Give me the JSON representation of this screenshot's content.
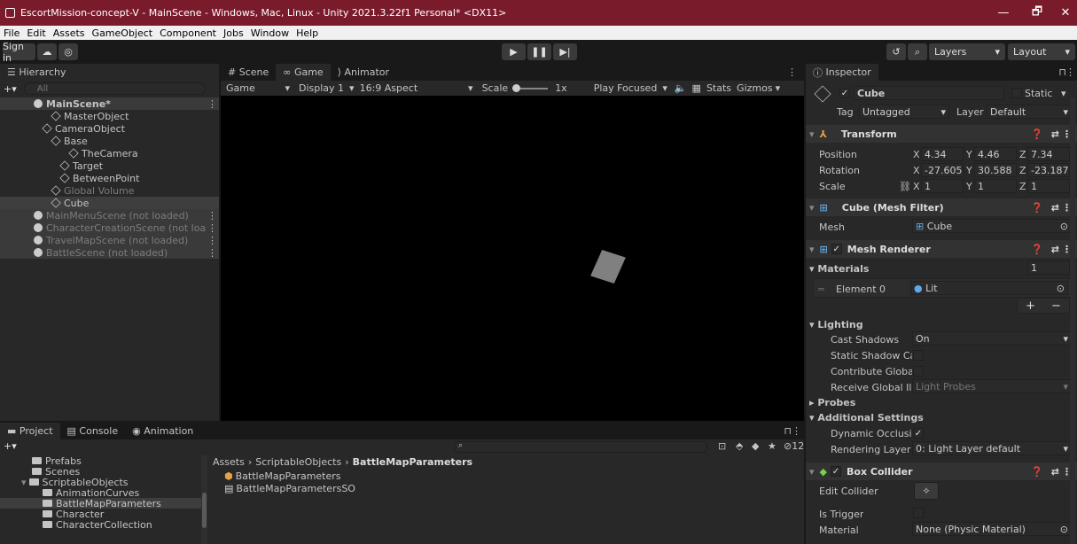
{
  "window": {
    "title": "EscortMission-concept-V - MainScene - Windows, Mac, Linux - Unity 2021.3.22f1 Personal* <DX11>",
    "minimize": "—",
    "maximize": "🗗",
    "close": "✕"
  },
  "menu": [
    "File",
    "Edit",
    "Assets",
    "GameObject",
    "Component",
    "Jobs",
    "Window",
    "Help"
  ],
  "toolbar": {
    "sign_in": "Sign in",
    "layers": "Layers",
    "layout": "Layout"
  },
  "hierarchy": {
    "tab": "Hierarchy",
    "search_placeholder": "All",
    "items": [
      {
        "label": "MainScene*",
        "indent": 0,
        "type": "scene",
        "bold": true
      },
      {
        "label": "MasterObject",
        "indent": 2,
        "type": "obj"
      },
      {
        "label": "CameraObject",
        "indent": 1,
        "type": "obj"
      },
      {
        "label": "Base",
        "indent": 2,
        "type": "obj"
      },
      {
        "label": "TheCamera",
        "indent": 4,
        "type": "obj"
      },
      {
        "label": "Target",
        "indent": 3,
        "type": "obj"
      },
      {
        "label": "BetweenPoint",
        "indent": 3,
        "type": "obj"
      },
      {
        "label": "Global Volume",
        "indent": 2,
        "type": "obj",
        "dim": true
      },
      {
        "label": "Cube",
        "indent": 2,
        "type": "obj",
        "selected": true
      },
      {
        "label": "MainMenuScene (not loaded)",
        "indent": 0,
        "type": "scene",
        "dim": true,
        "unloaded": true
      },
      {
        "label": "CharacterCreationScene (not loa",
        "indent": 0,
        "type": "scene",
        "dim": true,
        "unloaded": true
      },
      {
        "label": "TravelMapScene (not loaded)",
        "indent": 0,
        "type": "scene",
        "dim": true,
        "unloaded": true
      },
      {
        "label": "BattleScene (not loaded)",
        "indent": 0,
        "type": "scene",
        "dim": true,
        "unloaded": true
      }
    ]
  },
  "game": {
    "tabs": [
      "Scene",
      "Game",
      "Animator"
    ],
    "display_mode": "Game",
    "display": "Display 1",
    "aspect": "16:9 Aspect",
    "scale_label": "Scale",
    "scale_value": "1x",
    "play_focused": "Play Focused",
    "stats": "Stats",
    "gizmos": "Gizmos"
  },
  "inspector": {
    "tab": "Inspector",
    "object_name": "Cube",
    "static_label": "Static",
    "tag_label": "Tag",
    "tag_value": "Untagged",
    "layer_label": "Layer",
    "layer_value": "Default",
    "transform": {
      "title": "Transform",
      "position_label": "Position",
      "rotation_label": "Rotation",
      "scale_label": "Scale",
      "position": [
        "4.34",
        "4.46",
        "7.34"
      ],
      "rotation": [
        "-27.605",
        "30.588",
        "-23.187"
      ],
      "scale": [
        "1",
        "1",
        "1"
      ]
    },
    "mesh_filter": {
      "title": "Cube (Mesh Filter)",
      "mesh_label": "Mesh",
      "mesh_value": "Cube"
    },
    "mesh_renderer": {
      "title": "Mesh Renderer",
      "materials_label": "Materials",
      "materials_count": "1",
      "element0_label": "Element 0",
      "element0_value": "Lit",
      "lighting_label": "Lighting",
      "cast_shadows_label": "Cast Shadows",
      "cast_shadows_value": "On",
      "static_shadow_label": "Static Shadow Cas",
      "contribute_gi_label": "Contribute Global I",
      "receive_gi_label": "Receive Global Illu",
      "receive_gi_value": "Light Probes",
      "probes_label": "Probes",
      "additional_label": "Additional Settings",
      "dynamic_occlusion_label": "Dynamic Occlusio",
      "rendering_layer_label": "Rendering Layer M",
      "rendering_layer_value": "0: Light Layer default"
    },
    "box_collider": {
      "title": "Box Collider",
      "edit_label": "Edit Collider",
      "trigger_label": "Is Trigger",
      "material_label": "Material",
      "material_value": "None (Physic Material)"
    }
  },
  "project": {
    "tabs": [
      "Project",
      "Console",
      "Animation"
    ],
    "badge": "12",
    "breadcrumb": [
      "Assets",
      "ScriptableObjects",
      "BattleMapParameters"
    ],
    "tree": [
      {
        "label": "Prefabs",
        "indent": 1
      },
      {
        "label": "Scenes",
        "indent": 1
      },
      {
        "label": "ScriptableObjects",
        "indent": 0,
        "open": true
      },
      {
        "label": "AnimationCurves",
        "indent": 2
      },
      {
        "label": "BattleMapParameters",
        "indent": 2,
        "selected": true
      },
      {
        "label": "Character",
        "indent": 2
      },
      {
        "label": "CharacterCollection",
        "indent": 2
      }
    ],
    "files": [
      "BattleMapParameters",
      "BattleMapParametersSO"
    ]
  }
}
